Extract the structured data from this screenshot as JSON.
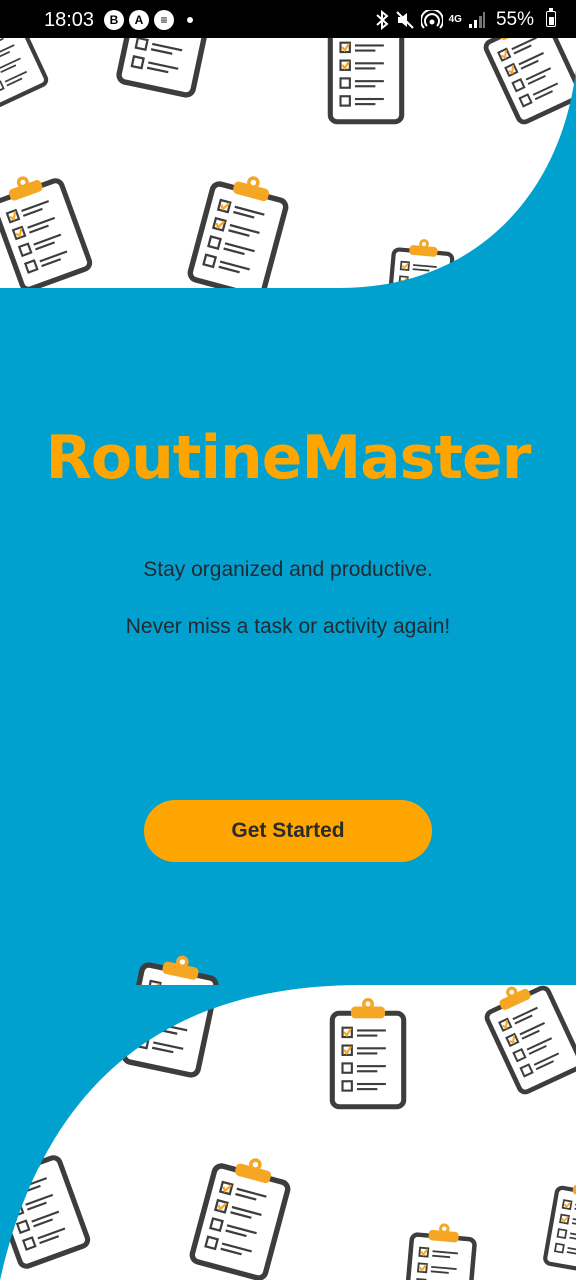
{
  "status_bar": {
    "time": "18:03",
    "notifications": [
      "B",
      "A",
      "≡"
    ],
    "network": "4G",
    "battery": "55%"
  },
  "main": {
    "title": "RoutineMaster",
    "tagline_1": "Stay organized and productive.",
    "tagline_2": "Never miss a task or activity again!",
    "cta_label": "Get Started"
  },
  "colors": {
    "primary_blue": "#00a1cf",
    "accent_orange": "#ffa500",
    "text_dark": "#222a33",
    "background": "#ffffff"
  },
  "icons": [
    "clipboard-icon",
    "bluetooth-icon",
    "mute-icon",
    "hotspot-icon",
    "signal-icon",
    "battery-icon"
  ]
}
